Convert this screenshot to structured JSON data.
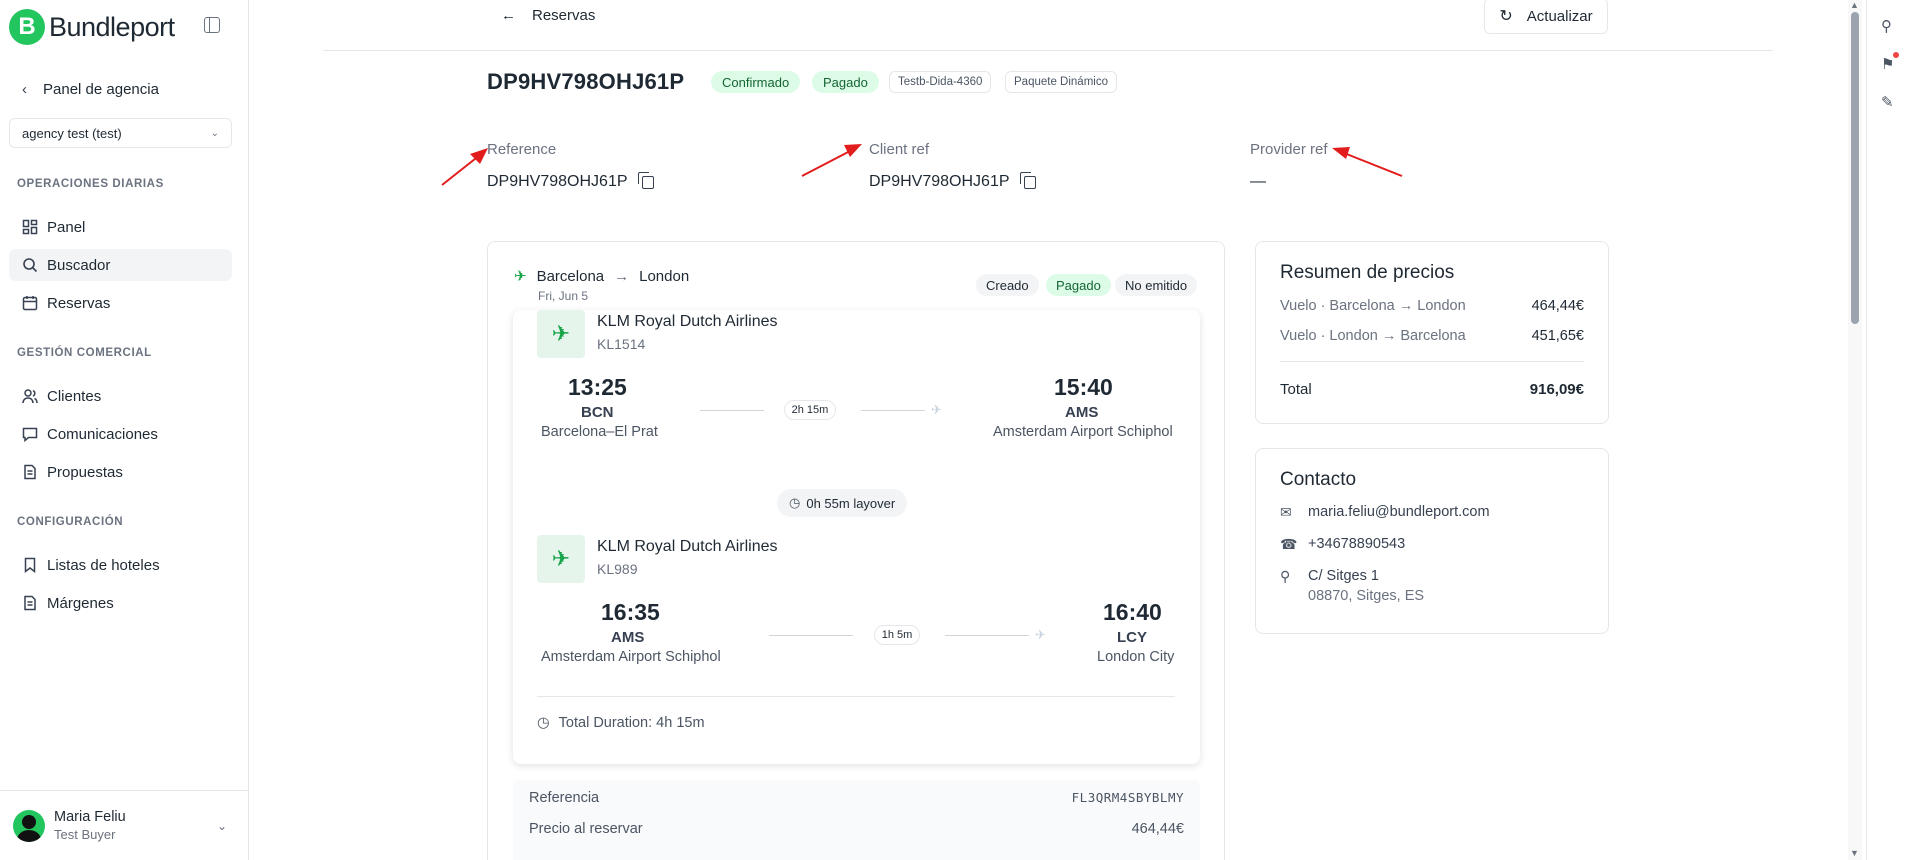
{
  "brand": {
    "name": "Bundleport",
    "mark": "B"
  },
  "sidebar": {
    "back_label": "Panel de agencia",
    "agency_select": "agency test (test)",
    "sections": [
      {
        "label": "OPERACIONES DIARIAS",
        "items": [
          {
            "label": "Panel",
            "icon": "grid-icon"
          },
          {
            "label": "Buscador",
            "icon": "search-icon"
          },
          {
            "label": "Reservas",
            "icon": "calendar-icon"
          }
        ]
      },
      {
        "label": "GESTIÓN COMERCIAL",
        "items": [
          {
            "label": "Clientes",
            "icon": "users-icon"
          },
          {
            "label": "Comunicaciones",
            "icon": "message-icon"
          },
          {
            "label": "Propuestas",
            "icon": "document-icon"
          }
        ]
      },
      {
        "label": "CONFIGURACIÓN",
        "items": [
          {
            "label": "Listas de hoteles",
            "icon": "bookmark-icon"
          },
          {
            "label": "Márgenes",
            "icon": "document-icon"
          }
        ]
      }
    ],
    "user": {
      "name": "Maria Feliu",
      "role": "Test Buyer"
    }
  },
  "header": {
    "back_label": "Reservas",
    "refresh_label": "Actualizar"
  },
  "booking": {
    "id": "DP9HV798OHJ61P",
    "badges": [
      "Confirmado",
      "Pagado"
    ],
    "tags": [
      "Testb-Dida-4360",
      "Paquete Dinámico"
    ],
    "refs": [
      {
        "label": "Reference",
        "value": "DP9HV798OHJ61P"
      },
      {
        "label": "Client ref",
        "value": "DP9HV798OHJ61P"
      },
      {
        "label": "Provider ref",
        "value": "—"
      }
    ]
  },
  "flight": {
    "origin": "Barcelona",
    "destination": "London",
    "date": "Fri, Jun 5",
    "chips": [
      "Creado",
      "Pagado",
      "No emitido"
    ],
    "segments": [
      {
        "airline": "KLM Royal Dutch Airlines",
        "number": "KL1514",
        "dep_time": "13:25",
        "dep_iata": "BCN",
        "dep_airport": "Barcelona–El Prat",
        "duration": "2h 15m",
        "arr_time": "15:40",
        "arr_iata": "AMS",
        "arr_airport": "Amsterdam Airport Schiphol"
      },
      {
        "airline": "KLM Royal Dutch Airlines",
        "number": "KL989",
        "dep_time": "16:35",
        "dep_iata": "AMS",
        "dep_airport": "Amsterdam Airport Schiphol",
        "duration": "1h 5m",
        "arr_time": "16:40",
        "arr_iata": "LCY",
        "arr_airport": "London City"
      }
    ],
    "layover": "0h 55m layover",
    "total_duration": "Total Duration: 4h 15m",
    "reference_label": "Referencia",
    "reference_value": "FL3QRM4SBYBLMY",
    "price_label": "Precio al reservar",
    "price_value": "464,44€"
  },
  "price_summary": {
    "title": "Resumen de precios",
    "rows": [
      {
        "label": "Vuelo · Barcelona → London",
        "amount": "464,44€"
      },
      {
        "label": "Vuelo · London → Barcelona",
        "amount": "451,65€"
      }
    ],
    "total_label": "Total",
    "total_amount": "916,09€"
  },
  "contact": {
    "title": "Contacto",
    "email": "maria.feliu@bundleport.com",
    "phone": "+34678890543",
    "address_line1": "C/ Sitges 1",
    "address_line2": "08870, Sitges, ES"
  },
  "colors": {
    "accent": "#22c55e",
    "badge_green_bg": "#dcfce7",
    "badge_green_text": "#166534",
    "annotation_arrow": "#e11d1d"
  }
}
